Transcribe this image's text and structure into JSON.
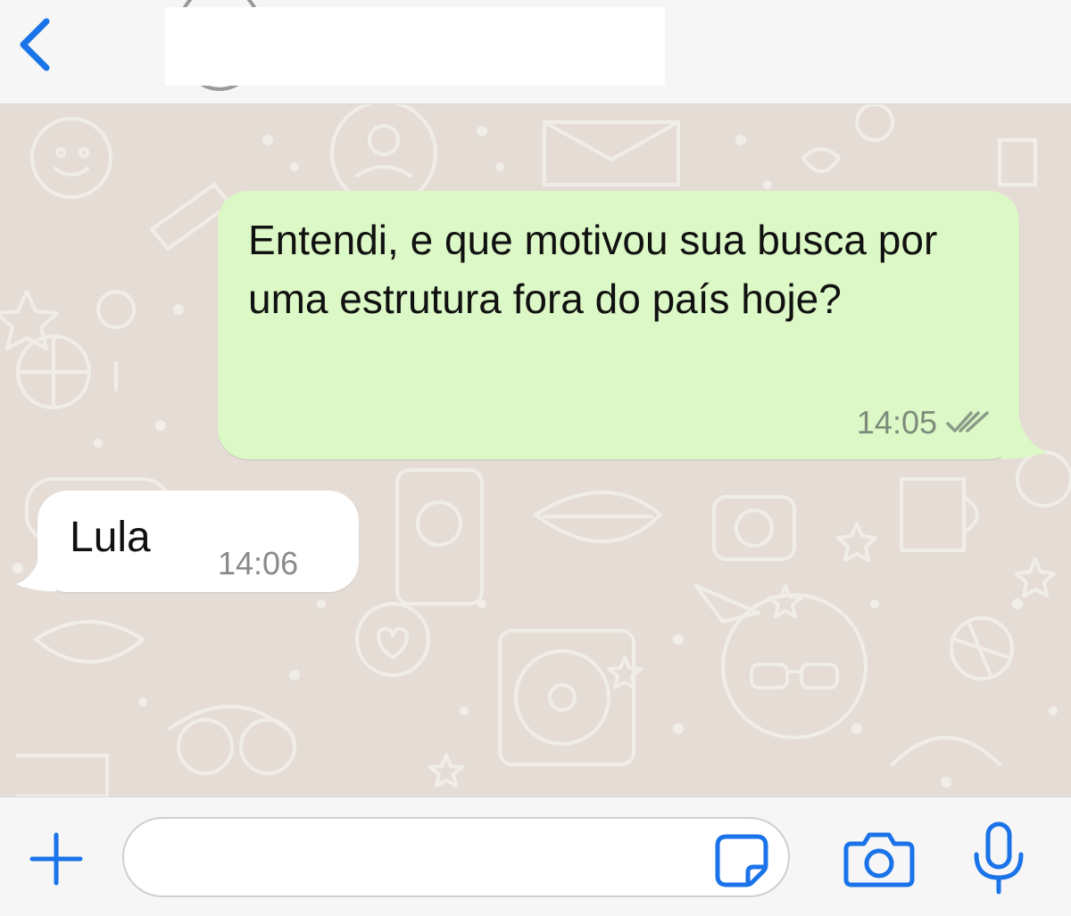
{
  "header": {
    "back_icon": "chevron-left-icon",
    "contact_name": "",
    "accent_color": "#1a73e8"
  },
  "messages": [
    {
      "direction": "outgoing",
      "text": "Entendi, e que motivou sua busca por uma estrutura fora do país hoje?",
      "time": "14:05",
      "status_icon": "double-check-icon",
      "bubble_color": "#dcf8c6"
    },
    {
      "direction": "incoming",
      "text": "Lula",
      "time": "14:06",
      "bubble_color": "#ffffff"
    }
  ],
  "input_bar": {
    "attach_icon": "plus-icon",
    "message_value": "",
    "sticker_icon": "sticker-icon",
    "camera_icon": "camera-icon",
    "mic_icon": "microphone-icon"
  }
}
